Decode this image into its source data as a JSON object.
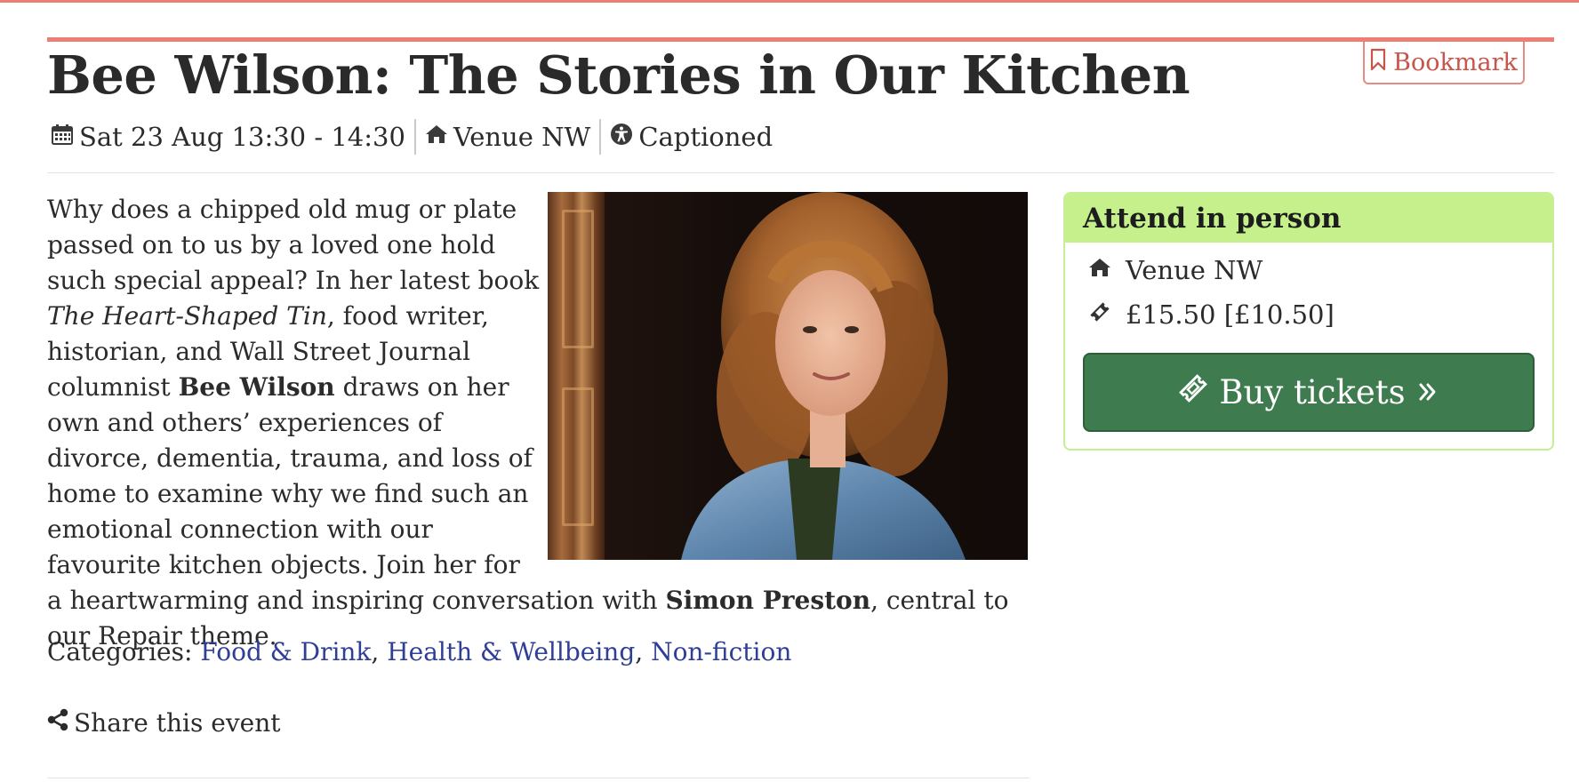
{
  "event": {
    "title": "Bee Wilson: The Stories in Our Kitchen",
    "date_time": "Sat 23 Aug 13:30 - 14:30",
    "venue": "Venue NW",
    "accessibility": "Captioned"
  },
  "bookmark": {
    "label": "Bookmark"
  },
  "description": {
    "p1": "Why does a chipped old mug or plate passed on to us by a loved one hold such special appeal? In her latest book ",
    "book_title": "The Heart-Shaped Tin",
    "p2": ", food writer, historian, and Wall Street Journal columnist ",
    "author": "Bee Wilson",
    "p3": " draws on her own and others’ experiences of divorce, dementia, trauma, and loss of home to examine why we find such an emotional connection with our favourite kitchen objects. Join her for a heartwarming and inspiring conversation with ",
    "host": "Simon Preston",
    "p4": ", central to our Repair theme."
  },
  "categories": {
    "label": "Categories: ",
    "items": [
      "Food & Drink",
      "Health & Wellbeing",
      "Non-fiction"
    ]
  },
  "share": {
    "label": "Share this event"
  },
  "attend": {
    "header": "Attend in person",
    "venue": "Venue NW",
    "price": "£15.50 [£10.50]",
    "buy_label": "Buy tickets"
  },
  "icons": {
    "calendar": "calendar-icon",
    "venue": "home-icon",
    "accessibility": "accessibility-icon",
    "bookmark": "bookmark-icon",
    "ticket": "ticket-icon",
    "chevrons": "double-chevron-right-icon",
    "share": "share-icon"
  },
  "colors": {
    "accent": "#ec7f73",
    "link": "#2f3f97",
    "attend_header": "#c5f08b",
    "buy_button": "#3e7b4f"
  }
}
